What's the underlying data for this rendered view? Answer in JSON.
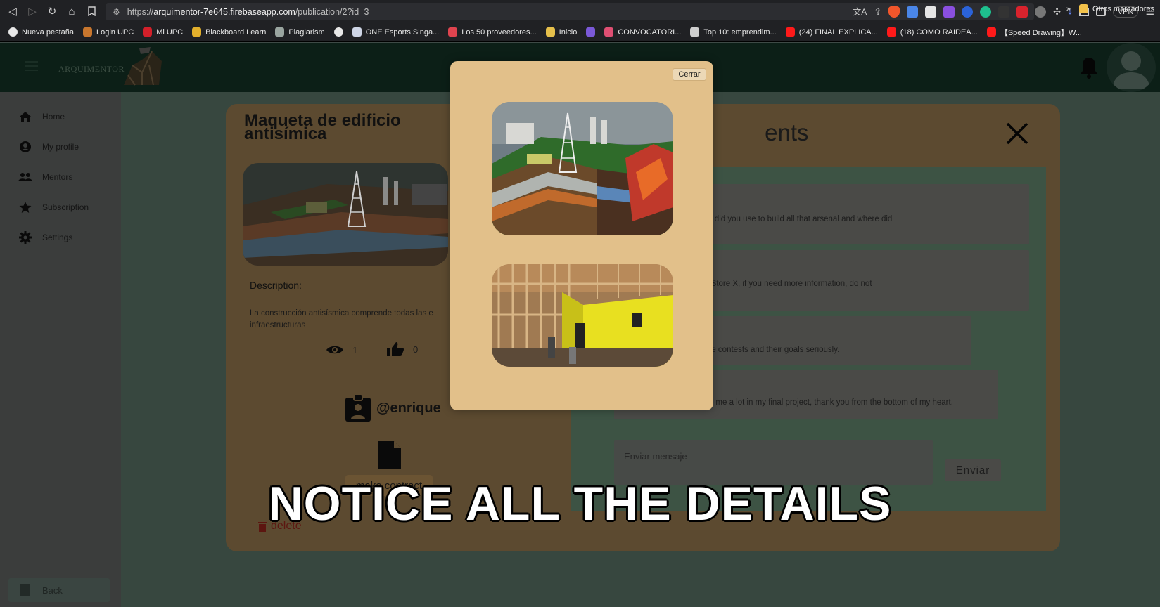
{
  "browser": {
    "url_prefix": "https://",
    "url_host": "arquimentor-7e645.firebaseapp.com",
    "url_path": "/publication/2?id=3",
    "vpn_label": "VPN",
    "bookmarks": [
      {
        "label": "Nueva pestaña",
        "icon": "globe-icon",
        "color": "#e8e8e8"
      },
      {
        "label": "Login UPC",
        "icon": "user-icon",
        "color": "#c9772e"
      },
      {
        "label": "Mi UPC",
        "icon": "upc-logo-icon",
        "color": "#d3202a"
      },
      {
        "label": "Blackboard Learn",
        "icon": "bars-icon",
        "color": "#e3b02c"
      },
      {
        "label": "Plagiarism",
        "icon": "wave-icon",
        "color": "#9aa5a0"
      },
      {
        "label": "",
        "icon": "globe-icon",
        "color": "#e8e8e8"
      },
      {
        "label": "ONE Esports Singa...",
        "icon": "esports-icon",
        "color": "#cfd6e6"
      },
      {
        "label": "Los 50 proveedores...",
        "icon": "target-icon",
        "color": "#e0444f"
      },
      {
        "label": "Inicio",
        "icon": "af-icon",
        "color": "#e6c04b"
      },
      {
        "label": "",
        "icon": "grid-icon",
        "color": "#7b59d8"
      },
      {
        "label": "CONVOCATORI...",
        "icon": "flag-icon",
        "color": "#e04f73"
      },
      {
        "label": "Top 10: emprendim...",
        "icon": "p-icon",
        "color": "#cfcfcf"
      },
      {
        "label": "(24) FINAL EXPLICA...",
        "icon": "youtube-icon",
        "color": "#ff1a1a"
      },
      {
        "label": "(18) COMO RAIDEA...",
        "icon": "youtube-icon",
        "color": "#ff1a1a"
      },
      {
        "label": "【Speed Drawing】W...",
        "icon": "youtube-icon",
        "color": "#ff1a1a"
      }
    ],
    "more_label": "»",
    "other_bookmarks": "Otros marcadores"
  },
  "app": {
    "logo_text": "ARQUIMENTOR",
    "sidebar": [
      {
        "label": "Home",
        "icon": "home-icon"
      },
      {
        "label": "My profile",
        "icon": "account-circle-icon"
      },
      {
        "label": "Mentors",
        "icon": "people-icon"
      },
      {
        "label": "Subscription",
        "icon": "star-icon"
      },
      {
        "label": "Settings",
        "icon": "gear-icon"
      }
    ],
    "back_label": "Back"
  },
  "publication": {
    "title": "Maqueta de edificio antisímica",
    "description_label": "Description:",
    "description": "La construcción antisísmica comprende todas las e infraestructuras",
    "views": "1",
    "likes": "0",
    "author": "@enrique",
    "contract_label": "make contract",
    "delete_label": "delete"
  },
  "comments": {
    "title": "Comments",
    "items": [
      "a question, what materials did you use to build all that arsenal and where did",
      "erial was purchased from Store X, if you need more information, do not",
      "are people who do take the contests and their goals seriously.",
      "Incredible work, it helped me a lot in my final project, thank you from the bottom of my heart."
    ],
    "input_placeholder": "Enviar mensaje",
    "send_label": "Enviar"
  },
  "modal": {
    "close_label": "Cerrar"
  },
  "caption": "NOTICE ALL THE DETAILS",
  "colors": {
    "modal_bg": "#e2c08a",
    "header_bg": "#0c1f17",
    "overlay_card": "#5c4a30",
    "delete_red": "#5c1610"
  }
}
